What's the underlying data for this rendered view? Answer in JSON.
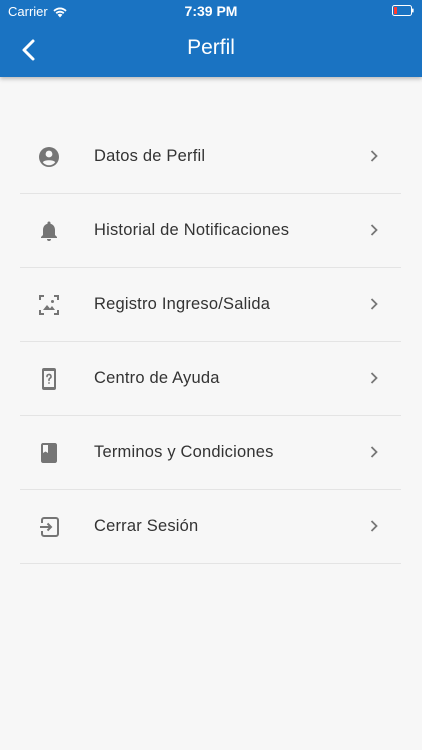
{
  "status_bar": {
    "carrier": "Carrier",
    "time": "7:39 PM"
  },
  "header": {
    "title": "Perfil",
    "back_icon": "back-arrow-icon",
    "color": "#1a73c2"
  },
  "menu": {
    "items": [
      {
        "label": "Datos de Perfil",
        "icon": "account-circle-icon"
      },
      {
        "label": "Historial de Notificaciones",
        "icon": "bell-icon"
      },
      {
        "label": "Registro Ingreso/Salida",
        "icon": "image-frame-icon"
      },
      {
        "label": "Centro de Ayuda",
        "icon": "phone-help-icon"
      },
      {
        "label": "Terminos y Condiciones",
        "icon": "book-icon"
      },
      {
        "label": "Cerrar Sesión",
        "icon": "logout-icon"
      }
    ]
  }
}
